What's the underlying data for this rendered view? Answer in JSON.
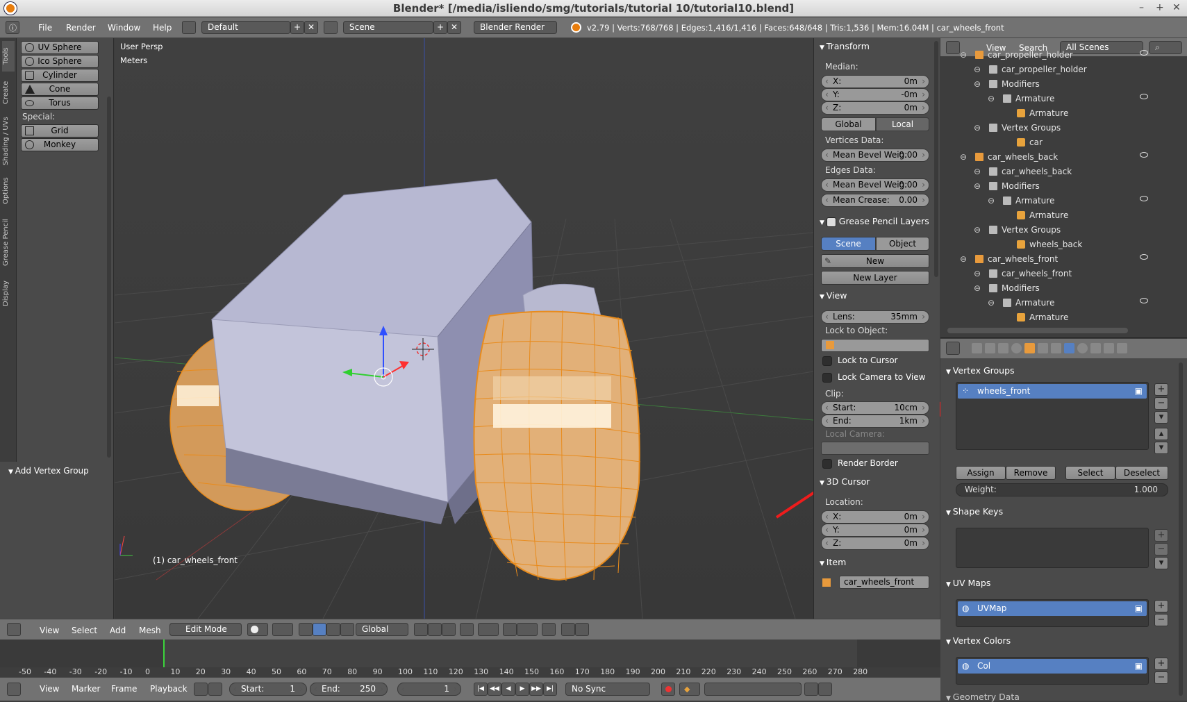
{
  "window": {
    "title": "Blender* [/media/isliendo/smg/tutorials/tutorial 10/tutorial10.blend]"
  },
  "topbar": {
    "menus": [
      "File",
      "Render",
      "Window",
      "Help"
    ],
    "layout": "Default",
    "scene": "Scene",
    "engine": "Blender Render",
    "stats": "v2.79 | Verts:768/768 | Edges:1,416/1,416 | Faces:648/648 | Tris:1,536 | Mem:16.04M | car_wheels_front"
  },
  "tool_tabs": [
    "Tools",
    "Create",
    "Shading / UVs",
    "Options",
    "Grease Pencil",
    "Display"
  ],
  "tools": {
    "buttons": [
      "UV Sphere",
      "Ico Sphere",
      "Cylinder",
      "Cone",
      "Torus"
    ],
    "special_label": "Special:",
    "special_buttons": [
      "Grid",
      "Monkey"
    ],
    "operator_panel": "Add Vertex Group"
  },
  "viewport": {
    "view_name": "User Persp",
    "units": "Meters",
    "object_label": "(1) car_wheels_front"
  },
  "npanel": {
    "transform": {
      "title": "Transform",
      "median_label": "Median:",
      "x": {
        "label": "X:",
        "value": "0m"
      },
      "y": {
        "label": "Y:",
        "value": "-0m"
      },
      "z": {
        "label": "Z:",
        "value": "0m"
      },
      "global": "Global",
      "local": "Local",
      "vertices_data": "Vertices Data:",
      "mean_bevel_v": {
        "label": "Mean Bevel Weig:",
        "value": "0.00"
      },
      "edges_data": "Edges Data:",
      "mean_bevel_e": {
        "label": "Mean Bevel Weig:",
        "value": "0.00"
      },
      "mean_crease": {
        "label": "Mean Crease:",
        "value": "0.00"
      }
    },
    "grease": {
      "title": "Grease Pencil Layers",
      "scene": "Scene",
      "object": "Object",
      "new": "New",
      "new_layer": "New Layer"
    },
    "view": {
      "title": "View",
      "lens": {
        "label": "Lens:",
        "value": "35mm"
      },
      "lock_to_object": "Lock to Object:",
      "lock_cursor": "Lock to Cursor",
      "lock_camera": "Lock Camera to View",
      "clip_label": "Clip:",
      "start": {
        "label": "Start:",
        "value": "10cm"
      },
      "end": {
        "label": "End:",
        "value": "1km"
      },
      "local_camera": "Local Camera:",
      "render_border": "Render Border"
    },
    "cursor": {
      "title": "3D Cursor",
      "location_label": "Location:",
      "x": {
        "label": "X:",
        "value": "0m"
      },
      "y": {
        "label": "Y:",
        "value": "0m"
      },
      "z": {
        "label": "Z:",
        "value": "0m"
      }
    },
    "item": {
      "title": "Item",
      "name": "car_wheels_front"
    }
  },
  "outliner": {
    "view": "View",
    "search": "Search",
    "filter": "All Scenes",
    "rows": [
      {
        "label": "car_propeller_holder",
        "indent": 1
      },
      {
        "label": "car_propeller_holder",
        "indent": 2
      },
      {
        "label": "Modifiers",
        "indent": 2
      },
      {
        "label": "Armature",
        "indent": 3
      },
      {
        "label": "Armature",
        "indent": 4
      },
      {
        "label": "Vertex Groups",
        "indent": 2
      },
      {
        "label": "car",
        "indent": 4
      },
      {
        "label": "car_wheels_back",
        "indent": 1
      },
      {
        "label": "car_wheels_back",
        "indent": 2
      },
      {
        "label": "Modifiers",
        "indent": 2
      },
      {
        "label": "Armature",
        "indent": 3
      },
      {
        "label": "Armature",
        "indent": 4
      },
      {
        "label": "Vertex Groups",
        "indent": 2
      },
      {
        "label": "wheels_back",
        "indent": 4
      },
      {
        "label": "car_wheels_front",
        "indent": 1
      },
      {
        "label": "car_wheels_front",
        "indent": 2
      },
      {
        "label": "Modifiers",
        "indent": 2
      },
      {
        "label": "Armature",
        "indent": 3
      },
      {
        "label": "Armature",
        "indent": 4
      }
    ]
  },
  "properties": {
    "vertex_groups": {
      "title": "Vertex Groups",
      "items": [
        "wheels_front"
      ]
    },
    "buttons": {
      "assign": "Assign",
      "remove": "Remove",
      "select": "Select",
      "deselect": "Deselect"
    },
    "weight": {
      "label": "Weight:",
      "value": "1.000"
    },
    "shape_keys": {
      "title": "Shape Keys"
    },
    "uv_maps": {
      "title": "UV Maps",
      "items": [
        "UVMap"
      ]
    },
    "vertex_colors": {
      "title": "Vertex Colors",
      "items": [
        "Col"
      ]
    },
    "geometry_data": {
      "title": "Geometry Data"
    }
  },
  "viewport_header": {
    "menus": [
      "View",
      "Select",
      "Add",
      "Mesh"
    ],
    "mode": "Edit Mode",
    "orientation": "Global"
  },
  "timeline": {
    "ticks": [
      "-50",
      "-40",
      "-30",
      "-20",
      "-10",
      "0",
      "10",
      "20",
      "30",
      "40",
      "50",
      "60",
      "70",
      "80",
      "90",
      "100",
      "110",
      "120",
      "130",
      "140",
      "150",
      "160",
      "170",
      "180",
      "190",
      "200",
      "210",
      "220",
      "230",
      "240",
      "250",
      "260",
      "270",
      "280"
    ],
    "current_frame": 1
  },
  "timeline_header": {
    "menus": [
      "View",
      "Marker",
      "Frame",
      "Playback"
    ],
    "start": {
      "label": "Start:",
      "value": "1"
    },
    "end": {
      "label": "End:",
      "value": "250"
    },
    "frame": "1",
    "sync": "No Sync"
  }
}
